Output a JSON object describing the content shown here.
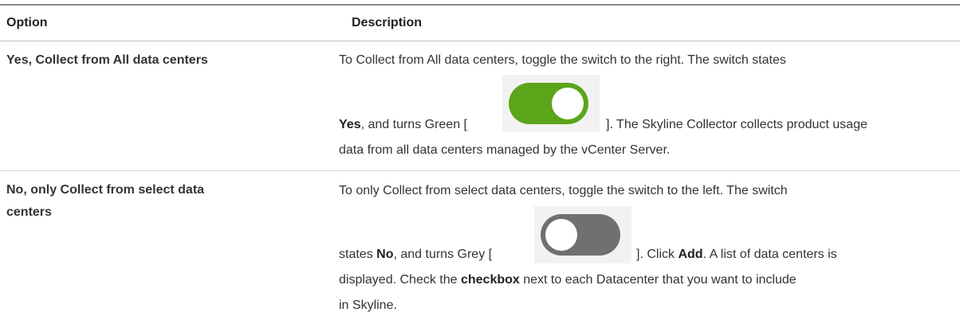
{
  "table": {
    "header": {
      "option": "Option",
      "description": "Description"
    },
    "rows": [
      {
        "option": "Yes, Collect from All data centers",
        "desc": {
          "line1": "To Collect from All data centers, toggle the switch to the right. The switch states",
          "bold1": "Yes",
          "mid1": ", and turns Green [",
          "after_switch": "]. The Skyline Collector collects product usage",
          "line3": "data from all data centers managed by the vCenter Server.",
          "switch_state": "on",
          "switch_color": "#5aa51a"
        }
      },
      {
        "option_line1": "No, only Collect from select data",
        "option_line2": "centers",
        "desc": {
          "line1": "To only Collect from select data centers, toggle the switch to the left. The switch",
          "pre_bold": "states ",
          "bold1": "No",
          "mid1": ", and turns Grey [",
          "after_switch": "]. Click ",
          "bold2": "Add",
          "tail2": ". A list of data centers is",
          "line3_pre": "displayed. Check the ",
          "bold3": "checkbox",
          "line3_post": " next to each Datacenter that you want to include",
          "line4": "in Skyline.",
          "switch_state": "off",
          "switch_color": "#707070"
        }
      }
    ]
  }
}
